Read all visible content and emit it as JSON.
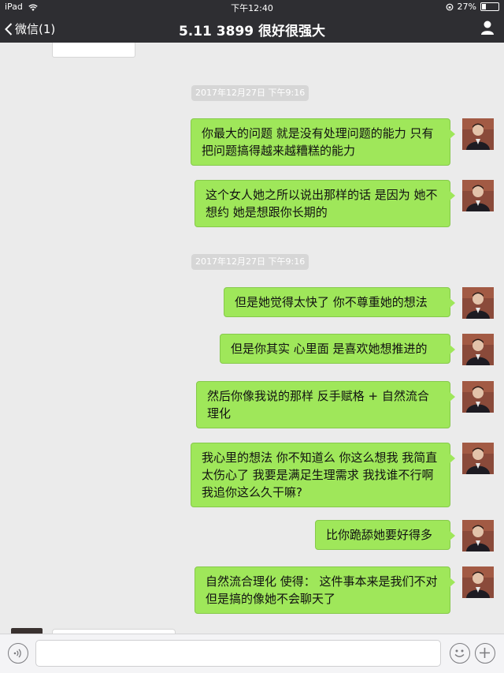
{
  "status_bar": {
    "device": "iPad",
    "time": "下午12:40",
    "battery_percent": "27%",
    "battery_level": 0.27
  },
  "nav": {
    "back_label": "微信(1)",
    "title": "5.11 3899 很好很强大"
  },
  "messages": [
    {
      "type": "timestamp",
      "text": "2017年12月27日 下午9:16"
    },
    {
      "type": "sent",
      "text": "你最大的问题 就是没有处理问题的能力  只有把问题搞得越来越糟糕的能力"
    },
    {
      "type": "sent",
      "text": "这个女人她之所以说出那样的话 是因为 她不想约 她是想跟你长期的"
    },
    {
      "type": "timestamp",
      "text": "2017年12月27日 下午9:16"
    },
    {
      "type": "sent",
      "text": "但是她觉得太快了 你不尊重她的想法"
    },
    {
      "type": "sent",
      "text": "但是你其实 心里面 是喜欢她想推进的"
    },
    {
      "type": "sent",
      "text": "然后你像我说的那样 反手赋格 + 自然流合理化"
    },
    {
      "type": "sent",
      "text": "我心里的想法 你不知道么 你这么想我 我简直太伤心了 我要是满足生理需求 我找谁不行啊 我追你这么久干嘛?"
    },
    {
      "type": "sent",
      "text": "比你跪舔她要好得多"
    },
    {
      "type": "sent",
      "text": "自然流合理化 使得： 这件事本来是我们不对 但是搞的像她不会聊天了"
    }
  ],
  "colors": {
    "nav_bg": "#2e2e32",
    "chat_bg": "#ebebeb",
    "bubble_green": "#9fe75a",
    "timestamp_bg": "#d6d6d6"
  },
  "icons": {
    "back": "chevron-left-icon",
    "contact": "person-icon",
    "voice": "voice-icon",
    "emoji": "emoji-icon",
    "more": "plus-icon"
  }
}
